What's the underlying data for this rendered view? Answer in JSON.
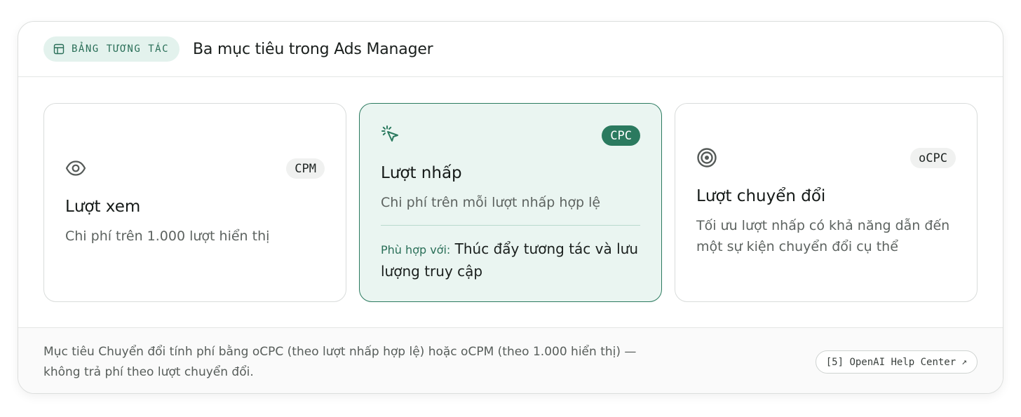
{
  "header": {
    "tag_label": "BẢNG TƯƠNG TÁC",
    "title": "Ba mục tiêu trong Ads Manager"
  },
  "cards": [
    {
      "icon": "eye-icon",
      "badge": "CPM",
      "title": "Lượt xem",
      "description": "Chi phí trên 1.000 lượt hiển thị"
    },
    {
      "icon": "cursor-click-icon",
      "badge": "CPC",
      "title": "Lượt nhấp",
      "description": "Chi phí trên mỗi lượt nhấp hợp lệ",
      "fit_label": "Phù hợp với:",
      "fit_text": "Thúc đẩy tương tác và lưu lượng truy cập",
      "selected": true
    },
    {
      "icon": "target-icon",
      "badge": "oCPC",
      "title": "Lượt chuyển đổi",
      "description": "Tối ưu lượt nhấp có khả năng dẫn đến một sự kiện chuyển đổi cụ thể"
    }
  ],
  "footer": {
    "note": "Mục tiêu Chuyển đổi tính phí bằng oCPC (theo lượt nhấp hợp lệ) hoặc oCPM (theo 1.000 hiển thị) — không trả phí theo lượt chuyển đổi.",
    "source_label": "[5] OpenAI Help Center",
    "source_icon": "external-link-icon"
  },
  "colors": {
    "accent": "#2b7a5f",
    "accent_bg": "#eaf5f1",
    "chip_bg": "#e3f2ed"
  }
}
